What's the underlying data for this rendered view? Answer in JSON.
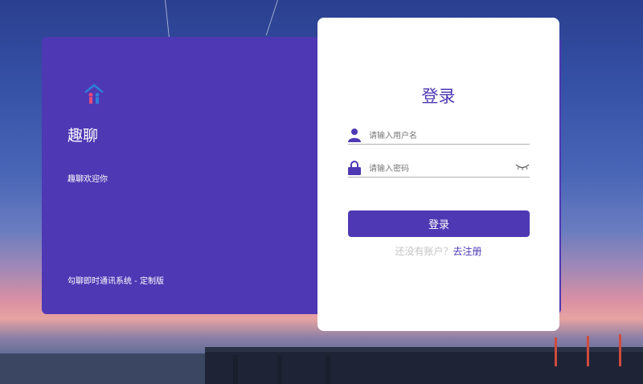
{
  "brand": {
    "name": "趣聊",
    "welcome": "趣聊欢迎你",
    "footer": "勾聊即时通讯系统 - 定制版"
  },
  "login": {
    "title": "登录",
    "username_placeholder": "请输入用户名",
    "password_placeholder": "请输入密码",
    "submit_label": "登录",
    "no_account_text": "还没有账户？",
    "register_link": "去注册"
  },
  "colors": {
    "accent": "#4e38b4",
    "card": "#ffffff"
  },
  "icons": {
    "logo": "app-logo-icon",
    "username": "user-icon",
    "password": "lock-icon",
    "toggle_password": "eye-closed-icon"
  }
}
